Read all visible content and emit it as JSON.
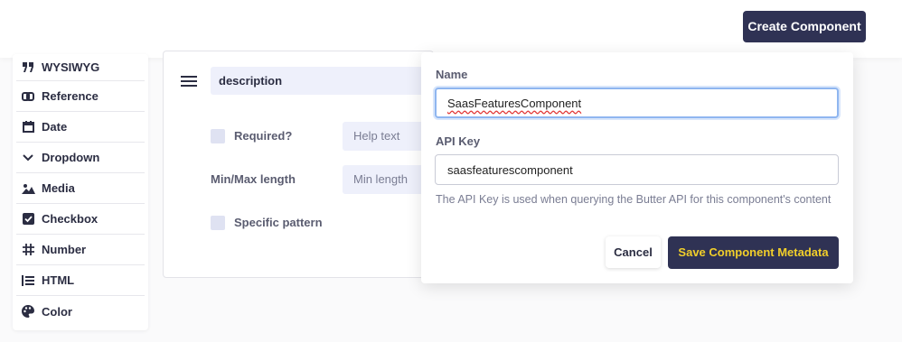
{
  "header": {
    "create_button": "Create Component"
  },
  "field_types": [
    {
      "label": "WYSIWYG",
      "icon": "quote-icon"
    },
    {
      "label": "Reference",
      "icon": "link-icon"
    },
    {
      "label": "Date",
      "icon": "calendar-icon"
    },
    {
      "label": "Dropdown",
      "icon": "chevron-down-icon"
    },
    {
      "label": "Media",
      "icon": "image-icon"
    },
    {
      "label": "Checkbox",
      "icon": "checkbox-icon"
    },
    {
      "label": "Number",
      "icon": "hash-icon"
    },
    {
      "label": "HTML",
      "icon": "list-icon"
    },
    {
      "label": "Color",
      "icon": "palette-icon"
    }
  ],
  "editor": {
    "field_name": "description",
    "required_label": "Required?",
    "help_text_placeholder": "Help text",
    "minmax_label": "Min/Max length",
    "min_length_placeholder": "Min length",
    "pattern_label": "Specific pattern"
  },
  "modal": {
    "name_label": "Name",
    "name_value": "SaasFeaturesComponent",
    "api_key_label": "API Key",
    "api_key_value": "saasfeaturescomponent",
    "help_text": "The API Key is used when querying the Butter API for this component's content",
    "cancel_label": "Cancel",
    "save_label": "Save Component Metadata"
  },
  "colors": {
    "primary": "#2f3254",
    "accent_text": "#f2cf2a",
    "input_bg": "#eef0fb"
  }
}
